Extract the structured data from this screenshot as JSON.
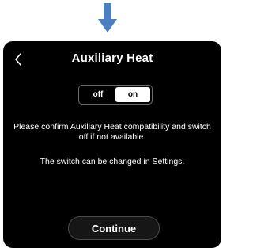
{
  "screen": {
    "title": "Auxiliary Heat",
    "back_icon": "chevron-left-icon"
  },
  "toggle": {
    "off_label": "off",
    "on_label": "on",
    "selected": "on"
  },
  "message": "Please confirm Auxiliary Heat compatibility and switch off if not available.",
  "note": "The switch can be changed in Settings.",
  "continue_label": "Continue",
  "colors": {
    "arrow": "#4a7fc1",
    "screen_bg": "#000000",
    "text": "#ffffff"
  }
}
